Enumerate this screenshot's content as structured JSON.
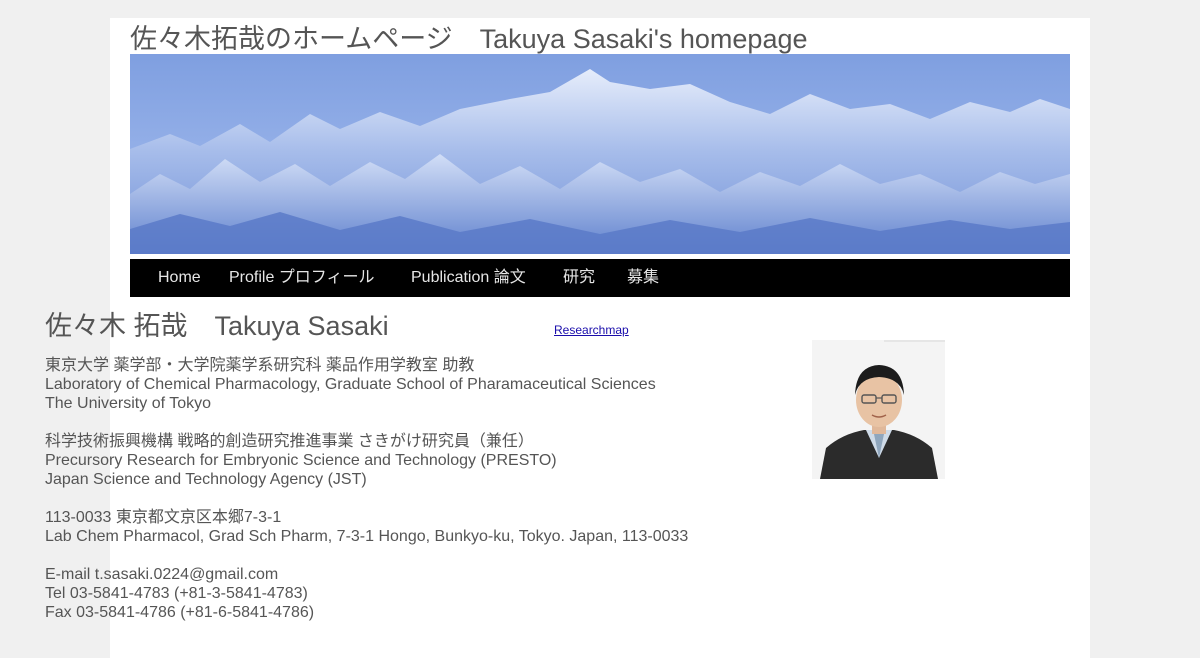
{
  "site": {
    "title": "佐々木拓哉のホームページ　Takuya Sasaki's homepage"
  },
  "nav": {
    "items": [
      {
        "label": "Home"
      },
      {
        "label": "Profile プロフィール"
      },
      {
        "label": "Publication 論文"
      },
      {
        "label": "研究"
      },
      {
        "label": "募集"
      }
    ]
  },
  "profile": {
    "name": "佐々木 拓哉　Takuya Sasaki",
    "researchmap_link": "Researchmap",
    "affiliation": [
      "東京大学  薬学部・大学院薬学系研究科  薬品作用学教室  助教",
      "Laboratory of Chemical Pharmacology, Graduate School of Pharamaceutical Sciences",
      "The University of Tokyo"
    ],
    "presto": [
      "科学技術振興機構  戦略的創造研究推進事業  さきがけ研究員（兼任）",
      "Precursory Research for Embryonic Science and Technology (PRESTO)",
      "Japan Science and Technology Agency (JST)"
    ],
    "address": [
      "113-0033 東京都文京区本郷7-3-1",
      "Lab Chem Pharmacol, Grad Sch Pharm, 7-3-1 Hongo, Bunkyo-ku, Tokyo. Japan, 113-0033"
    ],
    "contact": [
      "E-mail t.sasaki.0224@gmail.com",
      "Tel 03-5841-4783 (+81-3-5841-4783)",
      "Fax 03-5841-4786 (+81-6-5841-4786)"
    ]
  }
}
